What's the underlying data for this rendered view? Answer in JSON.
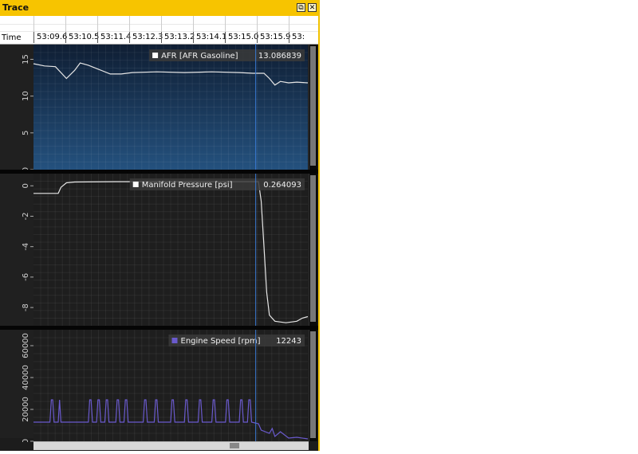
{
  "window": {
    "title": "Trace",
    "pin_glyph": "⧉",
    "close_glyph": "✕"
  },
  "time_axis": {
    "label": "Time",
    "ticks": [
      "53:09.6",
      "53:10.5",
      "53:11.4",
      "53:12.3",
      "53:13.2",
      "53:14.1",
      "53:15.0",
      "53:15.9",
      "53:"
    ]
  },
  "colors": {
    "accent": "#f7c400",
    "cursor": "#3a7bd5",
    "afr_fill_top": "#0f1e33",
    "afr_fill_bottom": "#24517e",
    "engine_speed": "#6a5acd"
  },
  "cursor": {
    "time_fraction": 0.81
  },
  "chart_data": [
    {
      "type": "line",
      "legend": "AFR [AFR Gasoline]",
      "value": "13.086839",
      "legend_color": "#ffffff",
      "ylim": [
        0,
        17
      ],
      "yticks": [
        "0",
        "5",
        "10",
        "15"
      ],
      "ytick_values": [
        0,
        5,
        10,
        15
      ],
      "x": [
        0,
        0.04,
        0.08,
        0.12,
        0.15,
        0.17,
        0.2,
        0.24,
        0.28,
        0.32,
        0.36,
        0.45,
        0.55,
        0.65,
        0.75,
        0.8,
        0.84,
        0.86,
        0.88,
        0.9,
        0.93,
        0.96,
        1.0
      ],
      "y": [
        14.4,
        14.1,
        14.0,
        12.4,
        13.5,
        14.5,
        14.2,
        13.6,
        13.0,
        13.0,
        13.2,
        13.3,
        13.2,
        13.3,
        13.2,
        13.1,
        13.1,
        12.4,
        11.5,
        12.0,
        11.8,
        11.9,
        11.8
      ]
    },
    {
      "type": "line",
      "legend": "Manifold Pressure [psi]",
      "value": "0.264093",
      "legend_color": "#ffffff",
      "ylim": [
        -9.2,
        0.8
      ],
      "yticks": [
        "0",
        "-2",
        "-4",
        "-6",
        "-8"
      ],
      "ytick_values": [
        0,
        -2,
        -4,
        -6,
        -8
      ],
      "x": [
        0,
        0.05,
        0.09,
        0.1,
        0.12,
        0.15,
        0.3,
        0.5,
        0.7,
        0.8,
        0.82,
        0.83,
        0.84,
        0.85,
        0.86,
        0.88,
        0.92,
        0.96,
        0.98,
        1.0
      ],
      "y": [
        -0.5,
        -0.5,
        -0.5,
        -0.1,
        0.2,
        0.25,
        0.27,
        0.27,
        0.27,
        0.27,
        0.27,
        -1.0,
        -4.0,
        -7.0,
        -8.5,
        -8.9,
        -9.0,
        -8.9,
        -8.7,
        -8.6
      ]
    },
    {
      "type": "line",
      "legend": "Engine Speed [rpm]",
      "value": "12243",
      "legend_color": "#6a5acd",
      "ylim": [
        0,
        70000
      ],
      "yticks": [
        "0",
        "20000",
        "40000",
        "60000"
      ],
      "ytick_values": [
        0,
        20000,
        40000,
        60000
      ],
      "x": [
        0,
        0.06,
        0.065,
        0.07,
        0.075,
        0.09,
        0.095,
        0.1,
        0.2,
        0.205,
        0.21,
        0.215,
        0.23,
        0.235,
        0.24,
        0.245,
        0.26,
        0.265,
        0.27,
        0.275,
        0.3,
        0.305,
        0.31,
        0.315,
        0.33,
        0.335,
        0.34,
        0.345,
        0.4,
        0.405,
        0.41,
        0.415,
        0.44,
        0.445,
        0.45,
        0.455,
        0.5,
        0.505,
        0.51,
        0.515,
        0.55,
        0.555,
        0.56,
        0.565,
        0.6,
        0.605,
        0.61,
        0.615,
        0.65,
        0.655,
        0.66,
        0.665,
        0.7,
        0.705,
        0.71,
        0.715,
        0.75,
        0.755,
        0.76,
        0.765,
        0.78,
        0.785,
        0.79,
        0.795,
        0.82,
        0.83,
        0.86,
        0.87,
        0.88,
        0.9,
        0.93,
        0.96,
        1.0
      ],
      "y": [
        12000,
        12000,
        26000,
        26000,
        12000,
        12000,
        26000,
        12000,
        12000,
        26000,
        26000,
        12000,
        12000,
        26000,
        26000,
        12000,
        12000,
        26000,
        26000,
        12000,
        12000,
        26000,
        26000,
        12000,
        12000,
        26000,
        26000,
        12000,
        12000,
        26000,
        26000,
        12000,
        12000,
        26000,
        26000,
        12000,
        12000,
        26000,
        26000,
        12000,
        12000,
        26000,
        26000,
        12000,
        12000,
        26000,
        26000,
        12000,
        12000,
        26000,
        26000,
        12000,
        12000,
        26000,
        26000,
        12000,
        12000,
        26000,
        26000,
        12000,
        12000,
        26000,
        26000,
        12000,
        11000,
        7000,
        5000,
        8000,
        3000,
        6000,
        2000,
        2500,
        1500
      ]
    }
  ]
}
